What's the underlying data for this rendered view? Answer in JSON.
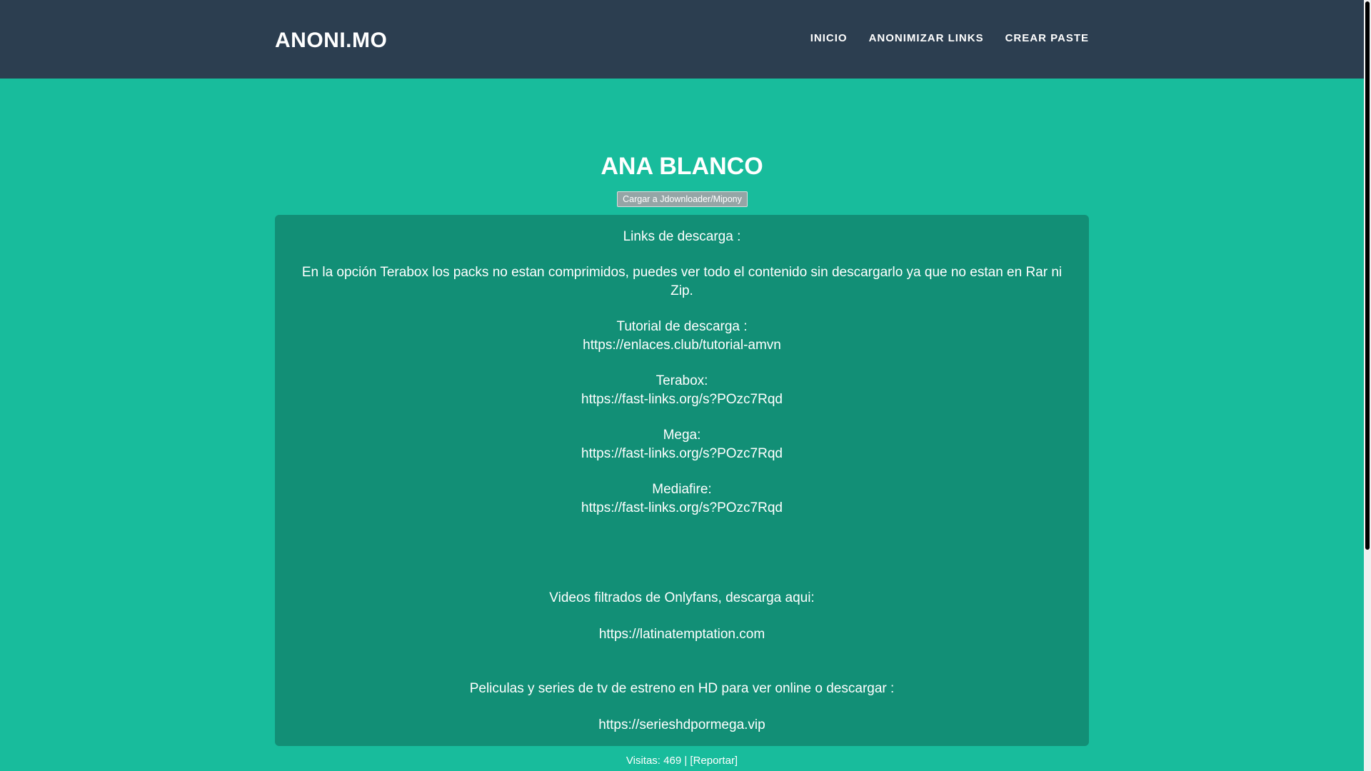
{
  "header": {
    "brand": "ANONI.MO",
    "nav": [
      {
        "label": "INICIO"
      },
      {
        "label": "ANONIMIZAR LINKS"
      },
      {
        "label": "CREAR PASTE"
      }
    ]
  },
  "page": {
    "title": "ANA BLANCO",
    "jd_button": "Cargar a Jdownloader/Mipony"
  },
  "content": {
    "links_heading": "Links de descarga :",
    "terabox_note": "En la opción Terabox los packs no estan comprimidos, puedes ver todo el contenido sin descargarlo ya que no estan en Rar ni Zip.",
    "tutorial_label": "Tutorial de descarga :",
    "tutorial_url": "https://enlaces.club/tutorial-amvn",
    "terabox_label": "Terabox:",
    "terabox_url": "https://fast-links.org/s?POzc7Rqd",
    "mega_label": "Mega:",
    "mega_url": "https://fast-links.org/s?POzc7Rqd",
    "mediafire_label": "Mediafire:",
    "mediafire_url": "https://fast-links.org/s?POzc7Rqd",
    "onlyfans_text": "Videos filtrados de Onlyfans, descarga aqui:",
    "onlyfans_url": "https://latinatemptation.com",
    "series_text": "Peliculas y series de tv de estreno en HD para ver online o descargar :",
    "series_url": "https://serieshdpormega.vip"
  },
  "footer": {
    "visits": "Visitas: 469 |",
    "report": "[Reportar]"
  },
  "colors": {
    "navbar": "#2c3e50",
    "background": "#18bc9c",
    "content_box": "#128f76",
    "button": "#95a5a6"
  }
}
